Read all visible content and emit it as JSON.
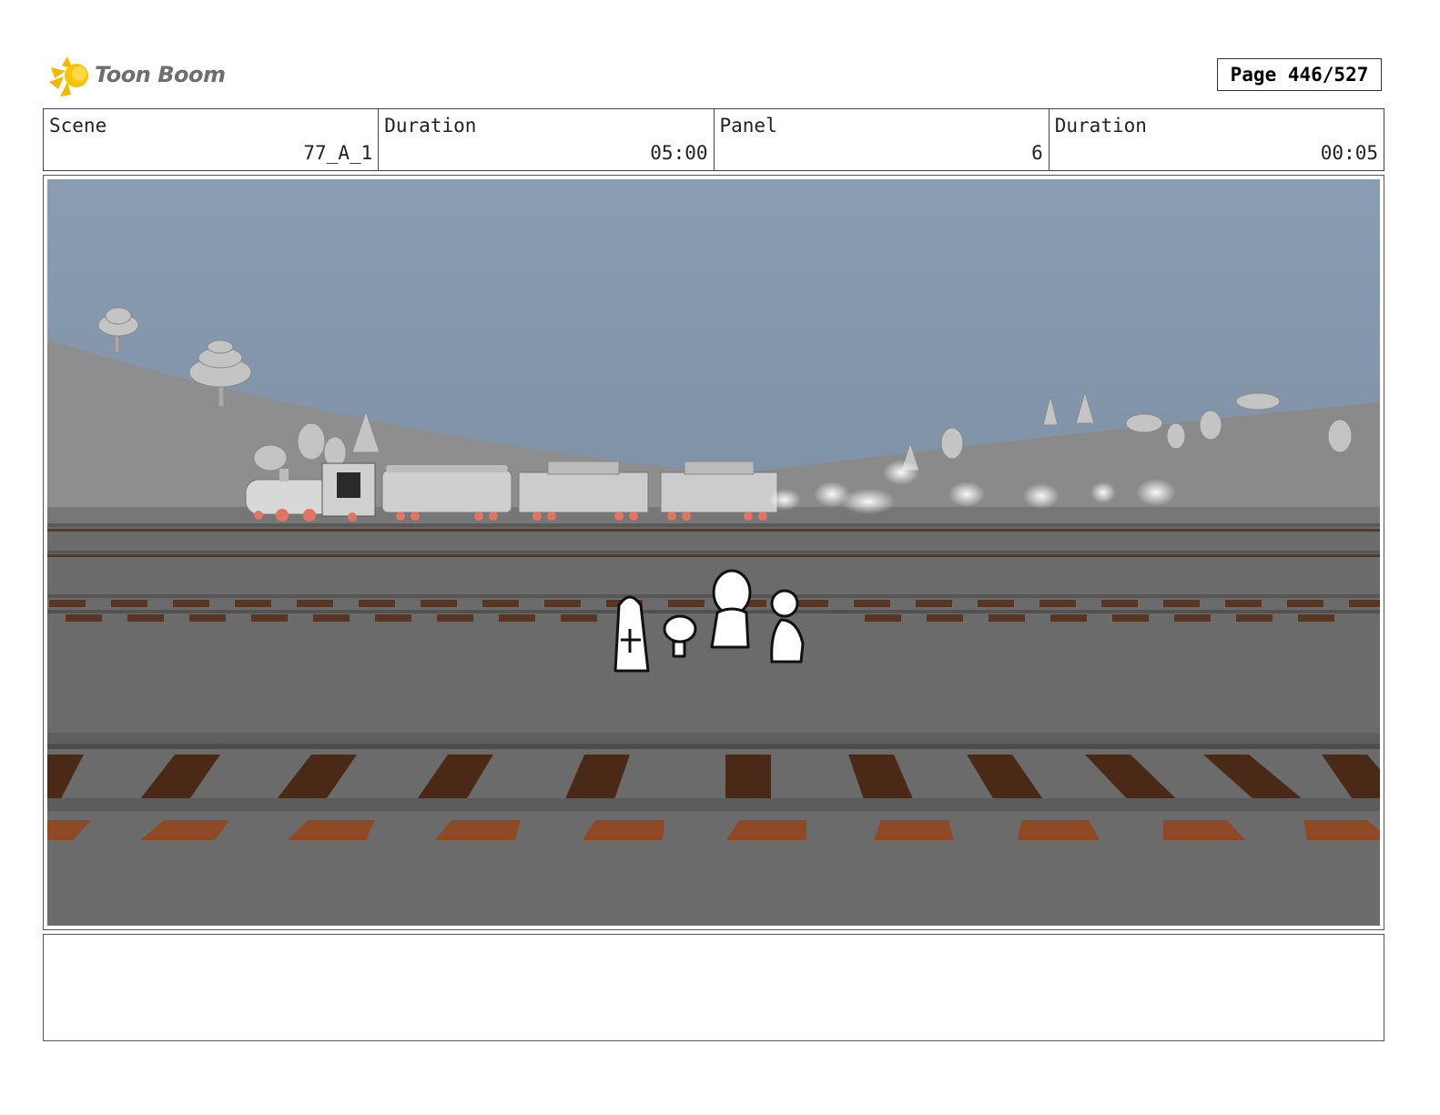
{
  "logo": {
    "text": "Toon Boom",
    "icon": "starburst-icon"
  },
  "page": {
    "label": "Page 446/527"
  },
  "header": {
    "scene_label": "Scene",
    "scene_value": "77_A_1",
    "duration_label": "Duration",
    "duration_value": "05:00",
    "panel_label": "Panel",
    "panel_value": "6",
    "panel_duration_label": "Duration",
    "panel_duration_value": "00:05"
  },
  "colors": {
    "sky_top": "#8a9db2",
    "sky_bottom": "#74879b",
    "ground": "#6b6b6b",
    "tie": "#5a3520",
    "wheel": "#e27462"
  },
  "notes": {
    "text": ""
  }
}
